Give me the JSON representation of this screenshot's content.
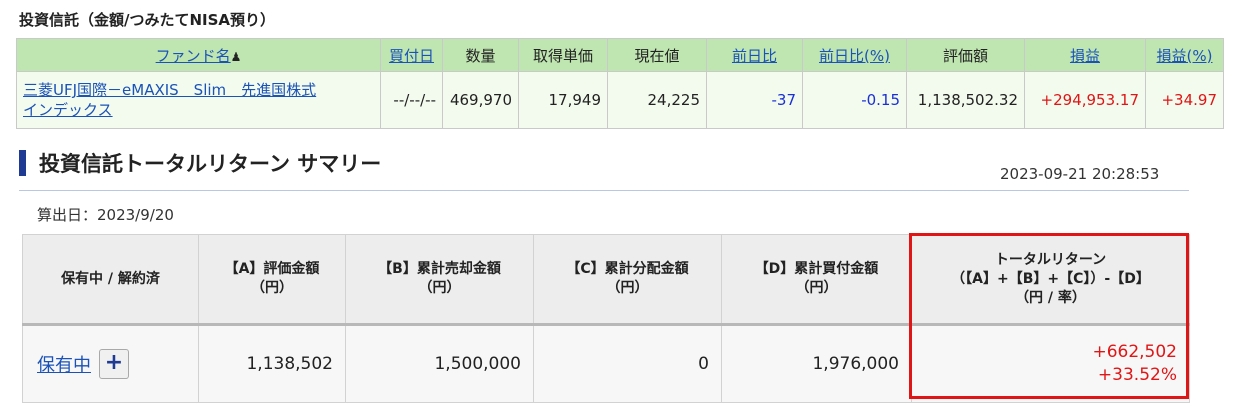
{
  "fund_section": {
    "title": "投資信託（金額/つみたてNISA預り）",
    "headers": {
      "fund_name": "ファンド名",
      "buy_date": "買付日",
      "quantity": "数量",
      "acquisition_price": "取得単価",
      "current_price": "現在値",
      "day_change": "前日比",
      "day_change_pct": "前日比(%)",
      "valuation": "評価額",
      "profit": "損益",
      "profit_pct": "損益(%)"
    },
    "sort_icon": "person-icon",
    "row": {
      "fund_name_line1": "三菱UFJ国際－eMAXIS　Slim　先進国株式",
      "fund_name_line2": "インデックス",
      "buy_date": "--/--/--",
      "quantity": "469,970",
      "acquisition_price": "17,949",
      "current_price": "24,225",
      "day_change": "-37",
      "day_change_pct": "-0.15",
      "valuation": "1,138,502.32",
      "profit": "+294,953.17",
      "profit_pct": "+34.97"
    }
  },
  "summary_section": {
    "title": "投資信託トータルリターン サマリー",
    "timestamp": "2023-09-21 20:28:53",
    "calc_date": "算出日：2023/9/20",
    "headers": {
      "status": "保有中 / 解約済",
      "a_line1": "【A】評価金額",
      "a_line2": "（円）",
      "b_line1": "【B】累計売却金額",
      "b_line2": "（円）",
      "c_line1": "【C】累計分配金額",
      "c_line2": "（円）",
      "d_line1": "【D】累計買付金額",
      "d_line2": "（円）",
      "total_line1": "トータルリターン",
      "total_line2": "（【A】+【B】+【C】）-【D】",
      "total_line3": "（円 / 率）"
    },
    "row": {
      "status_label": "保有中",
      "expand_label": "+",
      "a_value": "1,138,502",
      "b_value": "1,500,000",
      "c_value": "0",
      "d_value": "1,976,000",
      "total_yen": "+662,502",
      "total_rate": "+33.52%"
    }
  },
  "colors": {
    "header_green": "#bfe5b1",
    "link_blue": "#1a52b8",
    "negative_blue": "#1a2fd6",
    "positive_red": "#e01515",
    "accent_navy": "#1f3a93",
    "highlight_red": "#e01515"
  }
}
